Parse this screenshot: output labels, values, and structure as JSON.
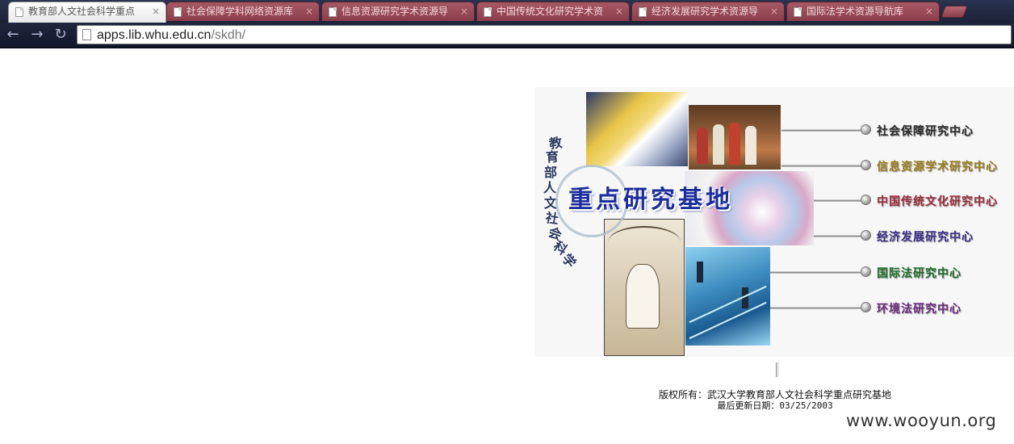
{
  "browser": {
    "tabs": [
      {
        "label": "教育部人文社会科学重点",
        "active": true
      },
      {
        "label": "社会保障学科网络资源库",
        "active": false
      },
      {
        "label": "信息资源研究学术资源导",
        "active": false
      },
      {
        "label": "中国传统文化研究学术资",
        "active": false
      },
      {
        "label": "经济发展研究学术资源导",
        "active": false
      },
      {
        "label": "国际法学术资源导航库",
        "active": false
      }
    ],
    "close_glyph": "×",
    "url_host": "apps.lib.whu.edu.cn",
    "url_path": "/skdh/",
    "nav": {
      "back": "←",
      "forward": "→",
      "reload": "↻"
    }
  },
  "banner": {
    "vertical_title": [
      "教",
      "育",
      "部",
      "人",
      "文",
      "社",
      "会",
      "科",
      "学"
    ],
    "main_title": "重点研究基地",
    "centers": [
      {
        "label": "社会保障研究中心",
        "color": "#2a2a2a"
      },
      {
        "label": "信息资源学术研究中心",
        "color": "#9b7d1e"
      },
      {
        "label": "中国传统文化研究中心",
        "color": "#9a2d3a"
      },
      {
        "label": "经济发展研究中心",
        "color": "#3a2f8a"
      },
      {
        "label": "国际法研究中心",
        "color": "#1f6d2a"
      },
      {
        "label": "环境法研究中心",
        "color": "#6b2a7e"
      }
    ]
  },
  "footer": {
    "copyright": "版权所有：武汉大学教育部人文社会科学重点研究基地",
    "updated": "最后更新日期：03/25/2003"
  },
  "watermark": "www.wooyun.org"
}
